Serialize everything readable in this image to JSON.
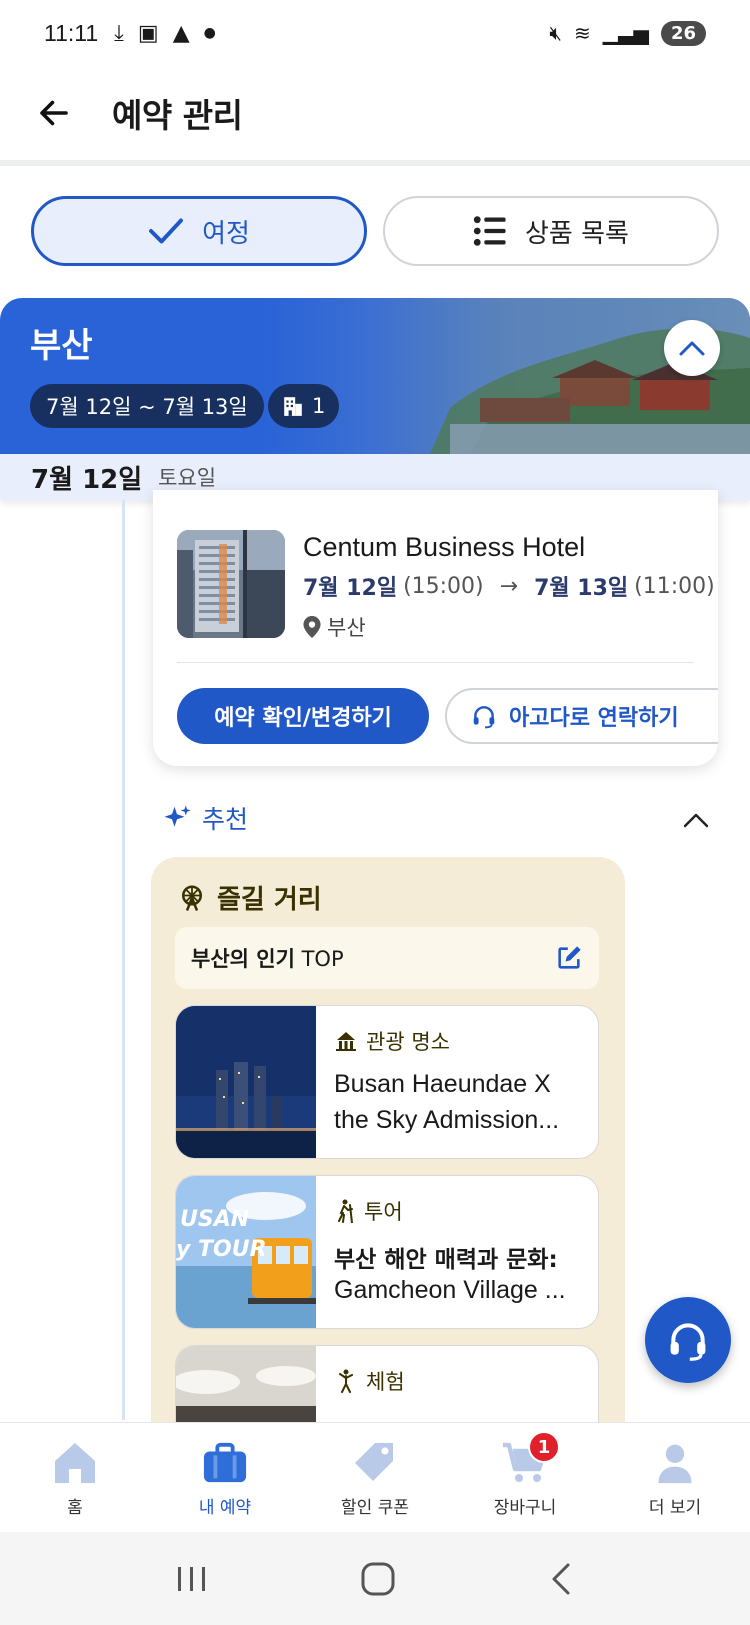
{
  "status_bar": {
    "time": "11:11",
    "battery": "26"
  },
  "header": {
    "title": "예약 관리"
  },
  "segments": {
    "itinerary": "여정",
    "products": "상품 목록"
  },
  "banner": {
    "city": "부산",
    "date_range": "7월 12일 ~ 7월 13일",
    "property_count": "1"
  },
  "date_strip": {
    "date": "7월 12일",
    "weekday": "토요일"
  },
  "hotel": {
    "name": "Centum Business Hotel",
    "checkin_date": "7월 12일",
    "checkin_time": "(15:00)",
    "checkout_date": "7월 13일",
    "checkout_time": "(11:00)",
    "location": "부산",
    "confirm_label": "예약 확인/변경하기",
    "contact_label": "아고다로 연락하기"
  },
  "recommendations": {
    "header": "추천",
    "section_title": "즐길 거리",
    "top_label_bold": "부산의 인기",
    "top_label_rest": " TOP",
    "items": [
      {
        "category": "관광 명소",
        "line1": "Busan Haeundae X",
        "line2": "the Sky Admission..."
      },
      {
        "category": "투어",
        "line1": "부산 해안 매력과 문화:",
        "line2": "Gamcheon Village ..."
      },
      {
        "category": "체험",
        "line1": "",
        "line2": ""
      }
    ]
  },
  "bottom_nav": [
    {
      "label": "홈",
      "icon": "home-icon"
    },
    {
      "label": "내 예약",
      "icon": "briefcase-icon"
    },
    {
      "label": "할인 쿠폰",
      "icon": "tag-icon"
    },
    {
      "label": "장바구니",
      "icon": "cart-icon",
      "badge": "1"
    },
    {
      "label": "더 보기",
      "icon": "person-icon"
    }
  ],
  "colors": {
    "primary": "#2158c8",
    "banner_dark": "#17305f",
    "panel_beige": "#f4ecd7",
    "badge_red": "#e0212b"
  }
}
